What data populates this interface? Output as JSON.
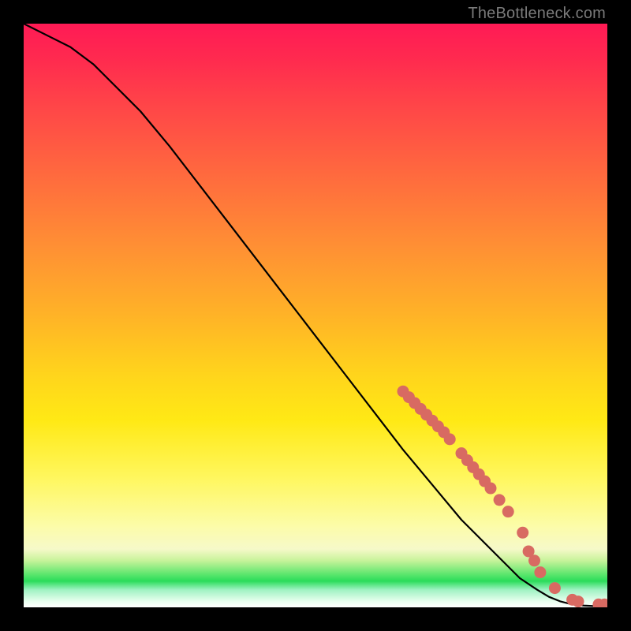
{
  "watermark": "TheBottleneck.com",
  "colors": {
    "background": "#000000",
    "curve_stroke": "#000000",
    "marker_fill": "#d86a62",
    "watermark_text": "#7a7a7a"
  },
  "chart_data": {
    "type": "line",
    "title": "",
    "xlabel": "",
    "ylabel": "",
    "xlim": [
      0,
      100
    ],
    "ylim": [
      0,
      100
    ],
    "grid": false,
    "series": [
      {
        "name": "curve",
        "x": [
          0,
          4,
          8,
          12,
          16,
          20,
          25,
          30,
          35,
          40,
          45,
          50,
          55,
          60,
          65,
          70,
          75,
          80,
          85,
          88,
          90,
          92,
          94,
          96,
          98,
          100
        ],
        "y": [
          100,
          98,
          96,
          93,
          89,
          85,
          79,
          72.5,
          66,
          59.5,
          53,
          46.5,
          40,
          33.5,
          27,
          21,
          15,
          10,
          5,
          3,
          1.8,
          1.0,
          0.5,
          0.3,
          0.2,
          0.2
        ]
      }
    ],
    "markers": {
      "name": "highlight-points",
      "points": [
        {
          "x": 65.0,
          "y": 37.0
        },
        {
          "x": 66.0,
          "y": 36.0
        },
        {
          "x": 67.0,
          "y": 35.0
        },
        {
          "x": 68.0,
          "y": 34.0
        },
        {
          "x": 69.0,
          "y": 33.0
        },
        {
          "x": 70.0,
          "y": 32.0
        },
        {
          "x": 71.0,
          "y": 31.0
        },
        {
          "x": 72.0,
          "y": 30.0
        },
        {
          "x": 73.0,
          "y": 28.8
        },
        {
          "x": 75.0,
          "y": 26.4
        },
        {
          "x": 76.0,
          "y": 25.2
        },
        {
          "x": 77.0,
          "y": 24.0
        },
        {
          "x": 78.0,
          "y": 22.8
        },
        {
          "x": 79.0,
          "y": 21.6
        },
        {
          "x": 80.0,
          "y": 20.4
        },
        {
          "x": 81.5,
          "y": 18.4
        },
        {
          "x": 83.0,
          "y": 16.4
        },
        {
          "x": 85.5,
          "y": 12.8
        },
        {
          "x": 86.5,
          "y": 9.6
        },
        {
          "x": 87.5,
          "y": 8.0
        },
        {
          "x": 88.5,
          "y": 6.0
        },
        {
          "x": 91.0,
          "y": 3.3
        },
        {
          "x": 94.0,
          "y": 1.3
        },
        {
          "x": 95.0,
          "y": 1.0
        },
        {
          "x": 98.5,
          "y": 0.5
        },
        {
          "x": 99.5,
          "y": 0.5
        }
      ]
    }
  }
}
